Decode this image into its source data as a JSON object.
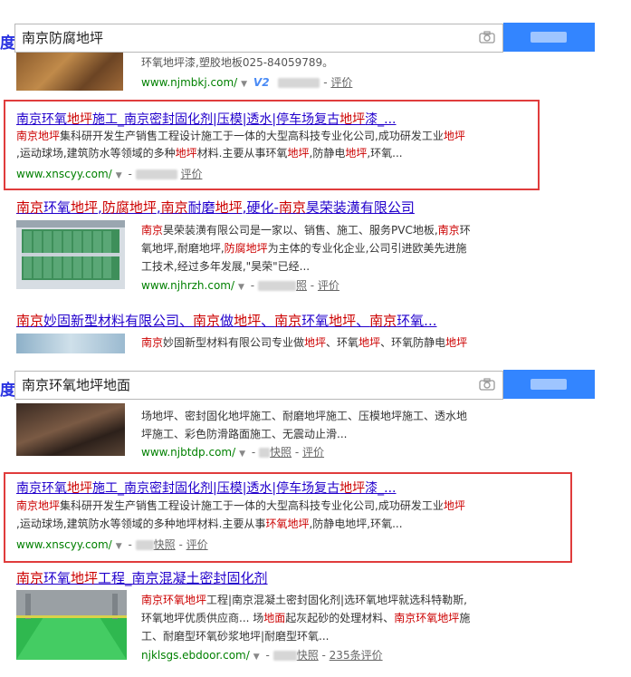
{
  "search1": {
    "logo": "度",
    "query": "南京防腐地坪"
  },
  "search2": {
    "logo": "度",
    "query": "南京环氧地坪地面"
  },
  "top_partial": {
    "desc": "环氧地坪漆,塑胶地板025-84059789。",
    "url": "www.njmbkj.com/",
    "v_badge": "V2",
    "review": "评价"
  },
  "r1": {
    "title_parts": [
      [
        "南京",
        0
      ],
      [
        "环氧",
        0
      ],
      [
        "地坪",
        1
      ],
      [
        "施工_南京密封固化剂|压模|透水|停车场复古",
        0
      ],
      [
        "地坪",
        1
      ],
      [
        "漆_...",
        0
      ]
    ],
    "desc1_parts": [
      [
        "南京",
        1
      ],
      [
        "地坪",
        1
      ],
      [
        "集科研开发生产销售工程设计施工于一体的大型高科技专业化公司,成功研发",
        0
      ],
      [
        "工业",
        0
      ],
      [
        "地坪",
        1
      ]
    ],
    "desc2_parts": [
      [
        ",运动球场,建筑防水等领域的多种",
        0
      ],
      [
        "地坪",
        1
      ],
      [
        "材料.主要从事环氧",
        0
      ],
      [
        "地坪",
        1
      ],
      [
        ",防静电",
        0
      ],
      [
        "地坪",
        1
      ],
      [
        ",环氧...",
        0
      ]
    ],
    "url": "www.xnscyy.com/",
    "review": "评价"
  },
  "r2": {
    "title_parts": [
      [
        "南京",
        1
      ],
      [
        "环氧",
        0
      ],
      [
        "地坪",
        1
      ],
      [
        ",",
        0
      ],
      [
        "防腐地坪",
        1
      ],
      [
        ",",
        0
      ],
      [
        "南京",
        1
      ],
      [
        "耐磨",
        0
      ],
      [
        "地坪",
        1
      ],
      [
        ",硬化-",
        0
      ],
      [
        "南京",
        1
      ],
      [
        "昊荣装潢有限公司",
        0
      ]
    ],
    "desc1_parts": [
      [
        "南京",
        1
      ],
      [
        "昊荣装潢有限公司是一家以、销售、施工、服务PVC地板,",
        0
      ],
      [
        "南京",
        1
      ],
      [
        "环",
        0
      ]
    ],
    "desc2_parts": [
      [
        "氧地坪,耐磨地坪,",
        0
      ],
      [
        "防腐地坪",
        1
      ],
      [
        "为主体的专业化企业,公司引进欧美先进施",
        0
      ]
    ],
    "desc3": "工技术,经过多年发展,\"昊荣\"已经...",
    "url": "www.njhrzh.com/",
    "snap": "照",
    "review": "评价"
  },
  "r3": {
    "title_parts": [
      [
        "南京",
        1
      ],
      [
        "妙固新型材料有限公司、",
        0
      ],
      [
        "南京",
        1
      ],
      [
        "做",
        0
      ],
      [
        "地坪",
        1
      ],
      [
        "、",
        0
      ],
      [
        "南京",
        1
      ],
      [
        "环氧",
        0
      ],
      [
        "地坪",
        1
      ],
      [
        "、",
        0
      ],
      [
        "南京",
        1
      ],
      [
        "环氧...",
        0
      ]
    ],
    "desc1_parts": [
      [
        "南京",
        1
      ],
      [
        "妙固新型材料有限公司专业做",
        0
      ],
      [
        "地坪",
        1
      ],
      [
        "、环氧",
        0
      ],
      [
        "地坪",
        1
      ],
      [
        "、环氧防静电",
        0
      ],
      [
        "地坪",
        1
      ]
    ]
  },
  "r4": {
    "desc1": "场地坪、密封固化地坪施工、耐磨地坪施工、压模地坪施工、透水地",
    "desc2": "坪施工、彩色防滑路面施工、无震动止滑...",
    "url": "www.njbtdp.com/",
    "snap": "快照",
    "review": "评价"
  },
  "r5": {
    "title_parts": [
      [
        "南京",
        0
      ],
      [
        "环氧",
        0
      ],
      [
        "地坪",
        1
      ],
      [
        "施工_南京密封固化剂|压模|透水|停车场复古",
        0
      ],
      [
        "地坪",
        1
      ],
      [
        "漆_...",
        0
      ]
    ],
    "desc1_parts": [
      [
        "南京",
        1
      ],
      [
        "地坪",
        1
      ],
      [
        "集科研开发生产销售工程设计施工于一体的大型高科技专业化公司,成功研发",
        0
      ],
      [
        "工业",
        0
      ],
      [
        "地坪",
        1
      ]
    ],
    "desc2_parts": [
      [
        ",运动球场,建筑防水等领域的多种地坪材料.主要从事",
        0
      ],
      [
        "环氧地坪",
        1
      ],
      [
        ",防静电地坪,环氧...",
        0
      ]
    ],
    "url": "www.xnscyy.com/",
    "snap": "快照",
    "review": "评价"
  },
  "r6": {
    "title_parts": [
      [
        "南京",
        1
      ],
      [
        "环氧",
        0
      ],
      [
        "地坪",
        1
      ],
      [
        "工程_南京混凝土密封固化剂",
        0
      ]
    ],
    "desc1_parts": [
      [
        "南京环氧地坪",
        1
      ],
      [
        "工程|南京混凝土密封固化剂|选环氧地坪就选科特勒斯,",
        0
      ]
    ],
    "desc2_parts": [
      [
        "环氧地坪优质供应商... 场",
        0
      ],
      [
        "地面",
        1
      ],
      [
        "起灰起砂的处理材料、",
        0
      ],
      [
        "南京环氧地坪",
        1
      ],
      [
        "施",
        0
      ]
    ],
    "desc3": "工、耐磨型环氧砂浆地坪|耐磨型环氧...",
    "url": "njklsgs.ebdoor.com/",
    "snap": "快照",
    "review": "235条评价"
  }
}
